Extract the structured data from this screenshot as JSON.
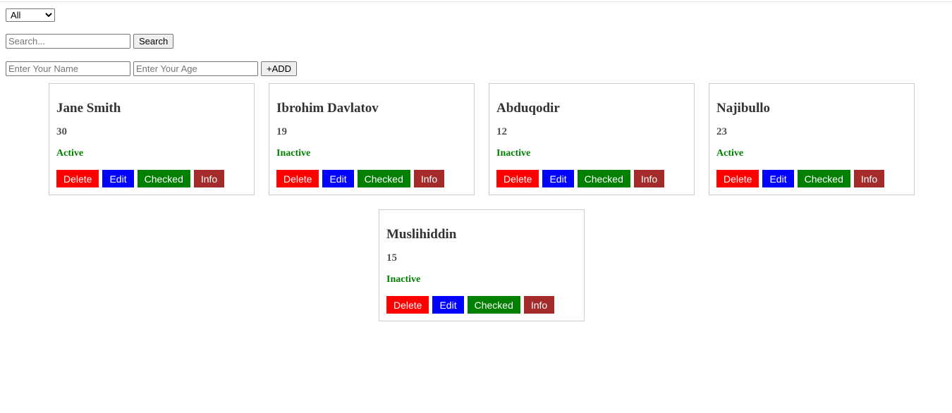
{
  "filter": {
    "selected": "All"
  },
  "search": {
    "placeholder": "Search...",
    "button_label": "Search"
  },
  "add_form": {
    "name_placeholder": "Enter Your Name",
    "age_placeholder": "Enter Your Age",
    "add_label": "+ADD"
  },
  "action_labels": {
    "delete": "Delete",
    "edit": "Edit",
    "checked": "Checked",
    "info": "Info"
  },
  "colors": {
    "delete": "#ff0000",
    "edit": "#0000ff",
    "checked": "#008000",
    "info": "#a52a2a",
    "status": "#008000"
  },
  "cards": [
    {
      "name": "Jane Smith",
      "age": "30",
      "status": "Active"
    },
    {
      "name": "Ibrohim Davlatov",
      "age": "19",
      "status": "Inactive"
    },
    {
      "name": "Abduqodir",
      "age": "12",
      "status": "Inactive"
    },
    {
      "name": "Najibullo",
      "age": "23",
      "status": "Active"
    },
    {
      "name": "Muslihiddin",
      "age": "15",
      "status": "Inactive"
    }
  ]
}
